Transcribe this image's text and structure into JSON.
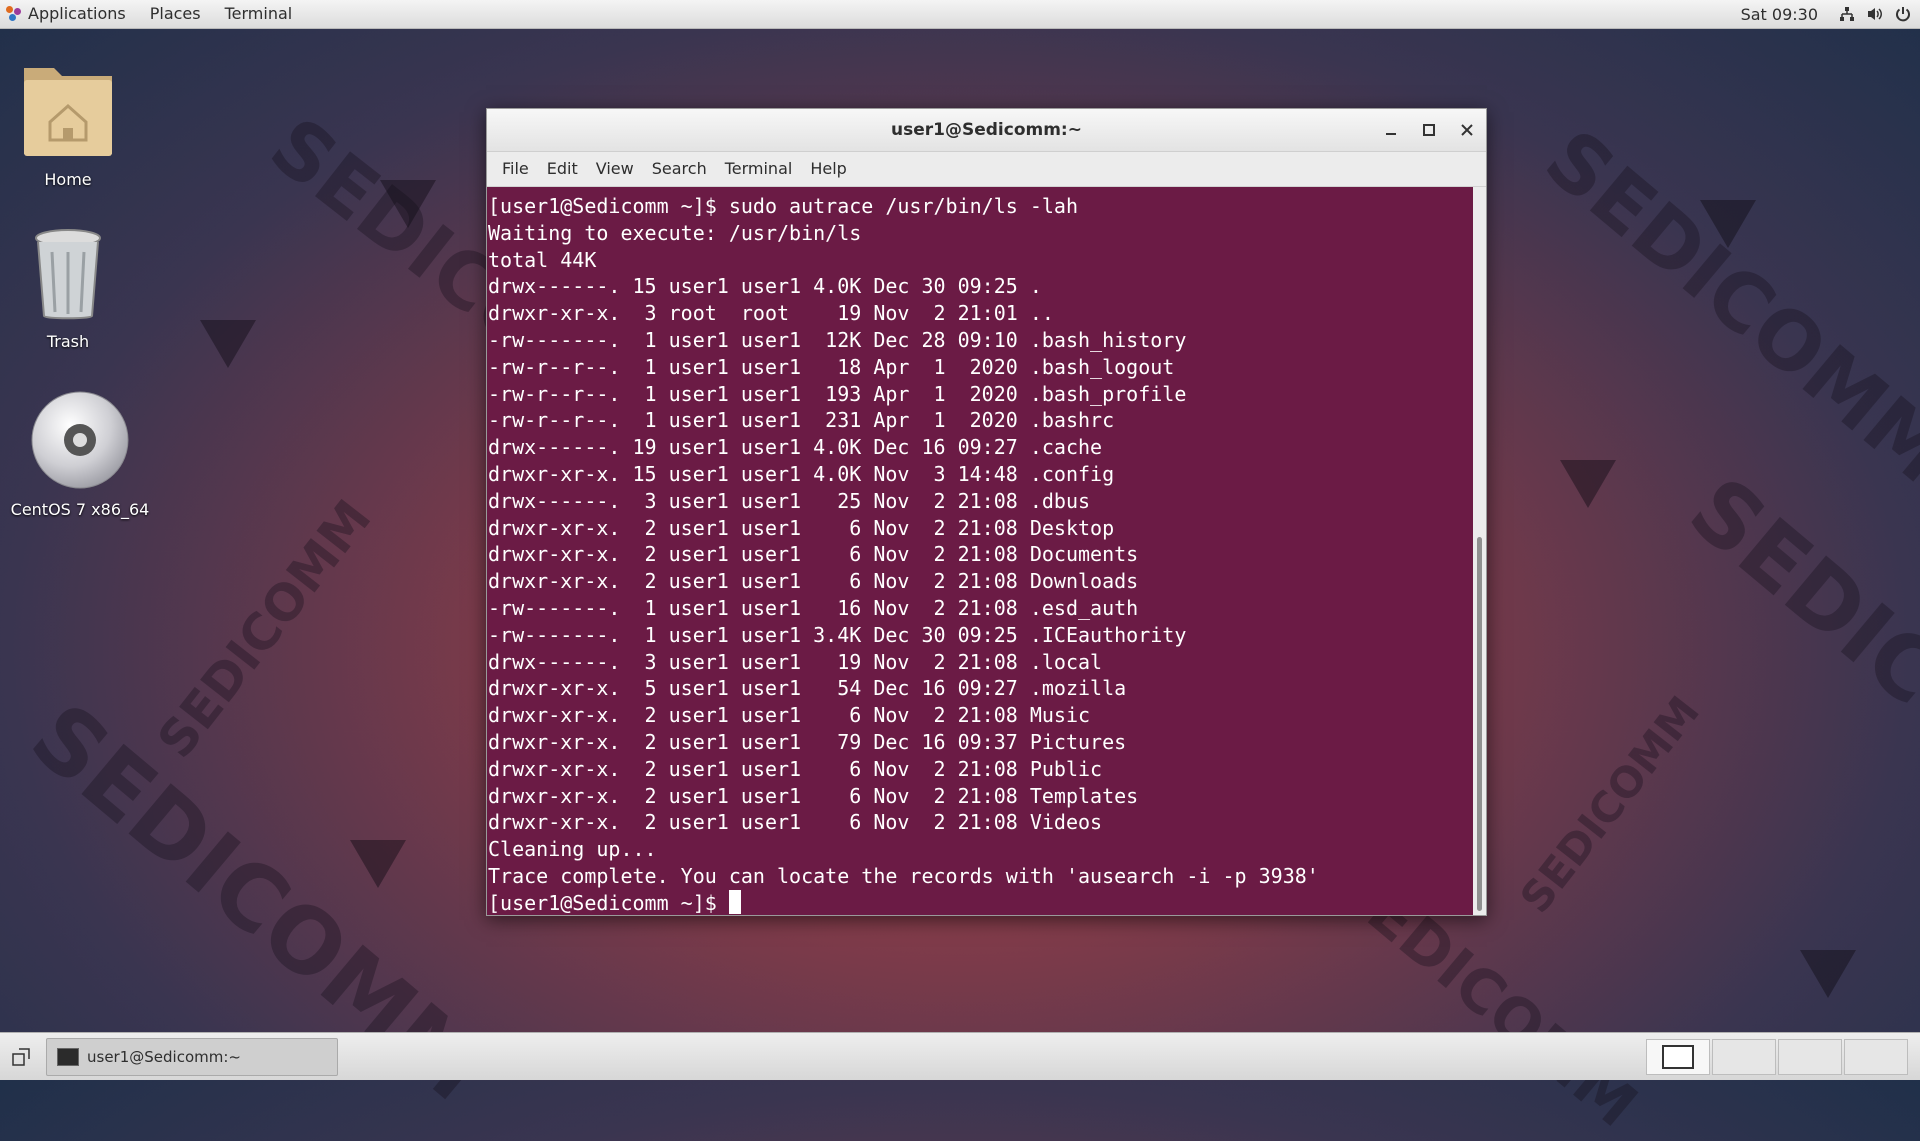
{
  "topbar": {
    "applications": "Applications",
    "places": "Places",
    "terminal": "Terminal",
    "clock": "Sat 09:30",
    "icons": [
      "network-icon",
      "volume-icon",
      "power-icon"
    ]
  },
  "desktop": {
    "icons": [
      {
        "label": "Home",
        "icon": "home-folder-icon"
      },
      {
        "label": "Trash",
        "icon": "trash-icon"
      },
      {
        "label": "CentOS 7 x86_64",
        "icon": "disc-icon"
      }
    ],
    "watermark": "SEDICOMM"
  },
  "window": {
    "title": "user1@Sedicomm:~",
    "buttons": [
      "minimize-icon",
      "maximize-icon",
      "close-icon"
    ],
    "menu": [
      "File",
      "Edit",
      "View",
      "Search",
      "Terminal",
      "Help"
    ],
    "terminal": {
      "lines": [
        "[user1@Sedicomm ~]$ sudo autrace /usr/bin/ls -lah",
        "Waiting to execute: /usr/bin/ls",
        "total 44K",
        "drwx------. 15 user1 user1 4.0K Dec 30 09:25 .",
        "drwxr-xr-x.  3 root  root    19 Nov  2 21:01 ..",
        "-rw-------.  1 user1 user1  12K Dec 28 09:10 .bash_history",
        "-rw-r--r--.  1 user1 user1   18 Apr  1  2020 .bash_logout",
        "-rw-r--r--.  1 user1 user1  193 Apr  1  2020 .bash_profile",
        "-rw-r--r--.  1 user1 user1  231 Apr  1  2020 .bashrc",
        "drwx------. 19 user1 user1 4.0K Dec 16 09:27 .cache",
        "drwxr-xr-x. 15 user1 user1 4.0K Nov  3 14:48 .config",
        "drwx------.  3 user1 user1   25 Nov  2 21:08 .dbus",
        "drwxr-xr-x.  2 user1 user1    6 Nov  2 21:08 Desktop",
        "drwxr-xr-x.  2 user1 user1    6 Nov  2 21:08 Documents",
        "drwxr-xr-x.  2 user1 user1    6 Nov  2 21:08 Downloads",
        "-rw-------.  1 user1 user1   16 Nov  2 21:08 .esd_auth",
        "-rw-------.  1 user1 user1 3.4K Dec 30 09:25 .ICEauthority",
        "drwx------.  3 user1 user1   19 Nov  2 21:08 .local",
        "drwxr-xr-x.  5 user1 user1   54 Dec 16 09:27 .mozilla",
        "drwxr-xr-x.  2 user1 user1    6 Nov  2 21:08 Music",
        "drwxr-xr-x.  2 user1 user1   79 Dec 16 09:37 Pictures",
        "drwxr-xr-x.  2 user1 user1    6 Nov  2 21:08 Public",
        "drwxr-xr-x.  2 user1 user1    6 Nov  2 21:08 Templates",
        "drwxr-xr-x.  2 user1 user1    6 Nov  2 21:08 Videos",
        "Cleaning up...",
        "Trace complete. You can locate the records with 'ausearch -i -p 3938'"
      ],
      "prompt": "[user1@Sedicomm ~]$ "
    }
  },
  "taskbar": {
    "task_label": "user1@Sedicomm:~",
    "workspaces": 4
  },
  "colors": {
    "terminal_bg": "#6b1b45",
    "terminal_fg": "#ffffff"
  }
}
